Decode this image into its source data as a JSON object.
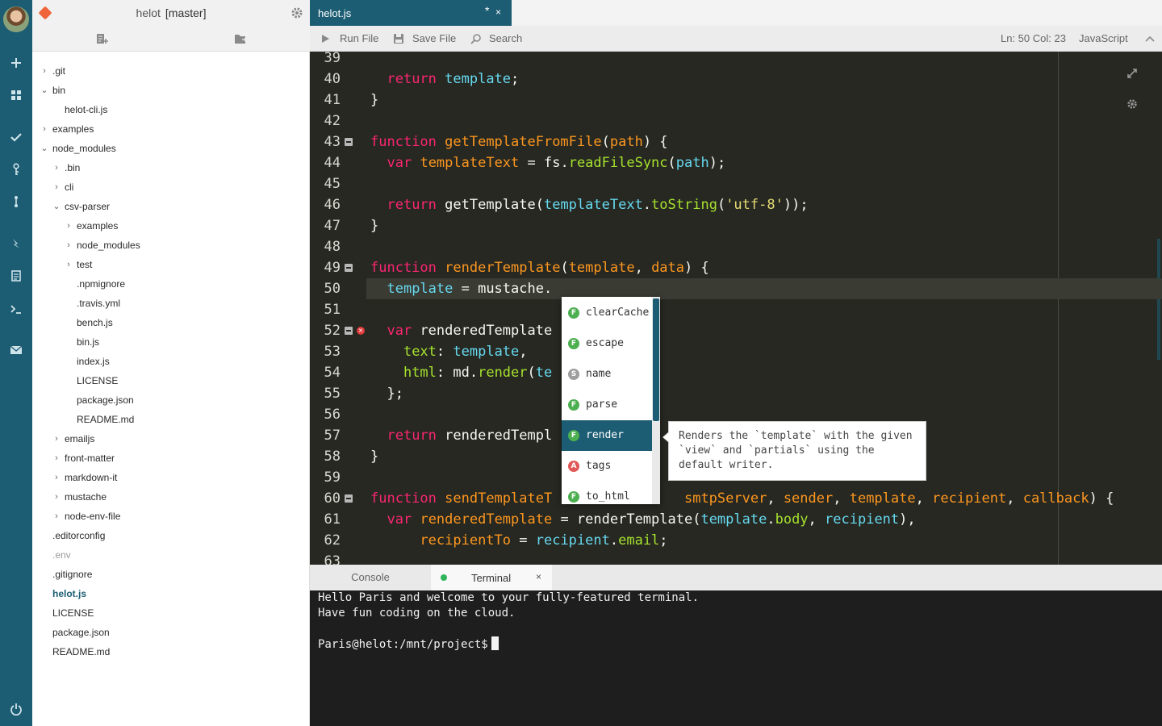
{
  "sidebar": {
    "project_name": "helot",
    "branch": "[master]",
    "tree": [
      {
        "label": ".git",
        "indent": 0,
        "type": "folder",
        "expanded": false
      },
      {
        "label": "bin",
        "indent": 0,
        "type": "folder",
        "expanded": true
      },
      {
        "label": "helot-cli.js",
        "indent": 1,
        "type": "file"
      },
      {
        "label": "examples",
        "indent": 0,
        "type": "folder",
        "expanded": false
      },
      {
        "label": "node_modules",
        "indent": 0,
        "type": "folder",
        "expanded": true
      },
      {
        "label": ".bin",
        "indent": 1,
        "type": "folder",
        "expanded": false
      },
      {
        "label": "cli",
        "indent": 1,
        "type": "folder",
        "expanded": false
      },
      {
        "label": "csv-parser",
        "indent": 1,
        "type": "folder",
        "expanded": true
      },
      {
        "label": "examples",
        "indent": 2,
        "type": "folder",
        "expanded": false
      },
      {
        "label": "node_modules",
        "indent": 2,
        "type": "folder",
        "expanded": false
      },
      {
        "label": "test",
        "indent": 2,
        "type": "folder",
        "expanded": false
      },
      {
        "label": ".npmignore",
        "indent": 2,
        "type": "file"
      },
      {
        "label": ".travis.yml",
        "indent": 2,
        "type": "file"
      },
      {
        "label": "bench.js",
        "indent": 2,
        "type": "file"
      },
      {
        "label": "bin.js",
        "indent": 2,
        "type": "file"
      },
      {
        "label": "index.js",
        "indent": 2,
        "type": "file"
      },
      {
        "label": "LICENSE",
        "indent": 2,
        "type": "file"
      },
      {
        "label": "package.json",
        "indent": 2,
        "type": "file"
      },
      {
        "label": "README.md",
        "indent": 2,
        "type": "file"
      },
      {
        "label": "emailjs",
        "indent": 1,
        "type": "folder",
        "expanded": false
      },
      {
        "label": "front-matter",
        "indent": 1,
        "type": "folder",
        "expanded": false
      },
      {
        "label": "markdown-it",
        "indent": 1,
        "type": "folder",
        "expanded": false
      },
      {
        "label": "mustache",
        "indent": 1,
        "type": "folder",
        "expanded": false
      },
      {
        "label": "node-env-file",
        "indent": 1,
        "type": "folder",
        "expanded": false
      },
      {
        "label": ".editorconfig",
        "indent": 0,
        "type": "file"
      },
      {
        "label": ".env",
        "indent": 0,
        "type": "file",
        "muted": true
      },
      {
        "label": ".gitignore",
        "indent": 0,
        "type": "file"
      },
      {
        "label": "helot.js",
        "indent": 0,
        "type": "file",
        "active": true
      },
      {
        "label": "LICENSE",
        "indent": 0,
        "type": "file"
      },
      {
        "label": "package.json",
        "indent": 0,
        "type": "file"
      },
      {
        "label": "README.md",
        "indent": 0,
        "type": "file"
      }
    ]
  },
  "editor": {
    "tab": {
      "title": "helot.js",
      "modified": "*",
      "close": "×"
    },
    "toolbar": {
      "run": "Run File",
      "save": "Save File",
      "search": "Search",
      "position": "Ln: 50 Col: 23",
      "language": "JavaScript"
    },
    "lines": [
      {
        "n": "39",
        "tokens": []
      },
      {
        "n": "40",
        "tokens": [
          [
            "",
            "  "
          ],
          [
            "kw",
            "return"
          ],
          [
            "",
            " "
          ],
          [
            "var",
            "template"
          ],
          [
            "",
            ";"
          ]
        ]
      },
      {
        "n": "41",
        "tokens": [
          [
            "",
            "}"
          ]
        ]
      },
      {
        "n": "42",
        "tokens": []
      },
      {
        "n": "43",
        "fold": true,
        "tokens": [
          [
            "kw",
            "function"
          ],
          [
            "",
            " "
          ],
          [
            "fn",
            "getTemplateFromFile"
          ],
          [
            "",
            "("
          ],
          [
            "fn",
            "path"
          ],
          [
            "",
            ") {"
          ]
        ]
      },
      {
        "n": "44",
        "tokens": [
          [
            "",
            "  "
          ],
          [
            "kw",
            "var"
          ],
          [
            "",
            " "
          ],
          [
            "fn",
            "templateText"
          ],
          [
            "",
            " = fs."
          ],
          [
            "prop",
            "readFileSync"
          ],
          [
            "",
            "("
          ],
          [
            "var",
            "path"
          ],
          [
            "",
            ");"
          ]
        ]
      },
      {
        "n": "45",
        "tokens": []
      },
      {
        "n": "46",
        "tokens": [
          [
            "",
            "  "
          ],
          [
            "kw",
            "return"
          ],
          [
            "",
            " getTemplate("
          ],
          [
            "var",
            "templateText"
          ],
          [
            "",
            "."
          ],
          [
            "prop",
            "toString"
          ],
          [
            "",
            "("
          ],
          [
            "str",
            "'utf-8'"
          ],
          [
            "",
            "));"
          ]
        ]
      },
      {
        "n": "47",
        "tokens": [
          [
            "",
            "}"
          ]
        ]
      },
      {
        "n": "48",
        "tokens": []
      },
      {
        "n": "49",
        "fold": true,
        "tokens": [
          [
            "kw",
            "function"
          ],
          [
            "",
            " "
          ],
          [
            "fn",
            "renderTemplate"
          ],
          [
            "",
            "("
          ],
          [
            "fn",
            "template"
          ],
          [
            "",
            ", "
          ],
          [
            "fn",
            "data"
          ],
          [
            "",
            ") {"
          ]
        ]
      },
      {
        "n": "50",
        "current": true,
        "tokens": [
          [
            "",
            "  "
          ],
          [
            "var",
            "template"
          ],
          [
            "",
            " = mustache."
          ]
        ]
      },
      {
        "n": "51",
        "tokens": []
      },
      {
        "n": "52",
        "fold": true,
        "error": true,
        "tokens": [
          [
            "",
            "  "
          ],
          [
            "kw",
            "var"
          ],
          [
            "",
            " renderedTemplate"
          ]
        ]
      },
      {
        "n": "53",
        "tokens": [
          [
            "",
            "    "
          ],
          [
            "prop",
            "text"
          ],
          [
            "",
            ": "
          ],
          [
            "var",
            "template"
          ],
          [
            "",
            ","
          ]
        ]
      },
      {
        "n": "54",
        "tokens": [
          [
            "",
            "    "
          ],
          [
            "prop",
            "html"
          ],
          [
            "",
            ": md."
          ],
          [
            "prop",
            "render"
          ],
          [
            "",
            "("
          ],
          [
            "var",
            "te"
          ]
        ]
      },
      {
        "n": "55",
        "tokens": [
          [
            "",
            "  };"
          ]
        ]
      },
      {
        "n": "56",
        "tokens": []
      },
      {
        "n": "57",
        "tokens": [
          [
            "",
            "  "
          ],
          [
            "kw",
            "return"
          ],
          [
            "",
            " renderedTempl"
          ]
        ]
      },
      {
        "n": "58",
        "tokens": [
          [
            "",
            "}"
          ]
        ]
      },
      {
        "n": "59",
        "tokens": []
      },
      {
        "n": "60",
        "fold": true,
        "tokens": [
          [
            "kw",
            "function"
          ],
          [
            "",
            " "
          ],
          [
            "fn",
            "sendTemplateT"
          ],
          [
            "",
            "                "
          ],
          [
            "fn",
            "smtpServer"
          ],
          [
            "",
            ", "
          ],
          [
            "fn",
            "sender"
          ],
          [
            "",
            ", "
          ],
          [
            "fn",
            "template"
          ],
          [
            "",
            ", "
          ],
          [
            "fn",
            "recipient"
          ],
          [
            "",
            ", "
          ],
          [
            "fn",
            "callback"
          ],
          [
            "",
            ") {"
          ]
        ]
      },
      {
        "n": "61",
        "tokens": [
          [
            "",
            "  "
          ],
          [
            "kw",
            "var"
          ],
          [
            "",
            " "
          ],
          [
            "fn",
            "renderedTemplate"
          ],
          [
            "",
            " = renderTemplate("
          ],
          [
            "var",
            "template"
          ],
          [
            "",
            "."
          ],
          [
            "prop",
            "body"
          ],
          [
            "",
            ", "
          ],
          [
            "var",
            "recipient"
          ],
          [
            "",
            "),"
          ]
        ]
      },
      {
        "n": "62",
        "tokens": [
          [
            "",
            "      "
          ],
          [
            "fn",
            "recipientTo"
          ],
          [
            "",
            " = "
          ],
          [
            "var",
            "recipient"
          ],
          [
            "",
            "."
          ],
          [
            "prop",
            "email"
          ],
          [
            "",
            ";"
          ]
        ]
      },
      {
        "n": "63",
        "tokens": []
      }
    ]
  },
  "autocomplete": {
    "items": [
      {
        "kind": "F",
        "label": "clearCache",
        "color": "#4caf50"
      },
      {
        "kind": "F",
        "label": "escape",
        "color": "#4caf50"
      },
      {
        "kind": "S",
        "label": "name",
        "color": "#9e9e9e"
      },
      {
        "kind": "F",
        "label": "parse",
        "color": "#4caf50"
      },
      {
        "kind": "F",
        "label": "render",
        "color": "#4caf50",
        "selected": true
      },
      {
        "kind": "A",
        "label": "tags",
        "color": "#e05858"
      },
      {
        "kind": "F",
        "label": "to_html",
        "color": "#4caf50"
      }
    ],
    "doc": "Renders the `template` with the given `view` and `partials` using the default writer."
  },
  "panel": {
    "tabs": {
      "console": "Console",
      "terminal": "Terminal",
      "close": "×"
    },
    "terminal_lines": [
      "Hello Paris and welcome to your fully-featured terminal.",
      "Have fun coding on the cloud.",
      "",
      "Paris@helot:/mnt/project$"
    ]
  },
  "colors": {
    "accent": "#1c5d73",
    "editor_bg": "#272822",
    "terminal_bg": "#1e1e1e"
  },
  "icons": [
    "avatar",
    "plus-icon",
    "grid-icon",
    "check-icon",
    "key-icon",
    "git-branch-icon",
    "lightning-icon",
    "document-icon",
    "terminal-icon",
    "mail-icon",
    "power-icon",
    "git-icon",
    "gear-icon",
    "new-file-icon",
    "new-folder-icon",
    "play-icon",
    "save-icon",
    "search-icon",
    "chevron-up-icon",
    "expand-icon"
  ]
}
